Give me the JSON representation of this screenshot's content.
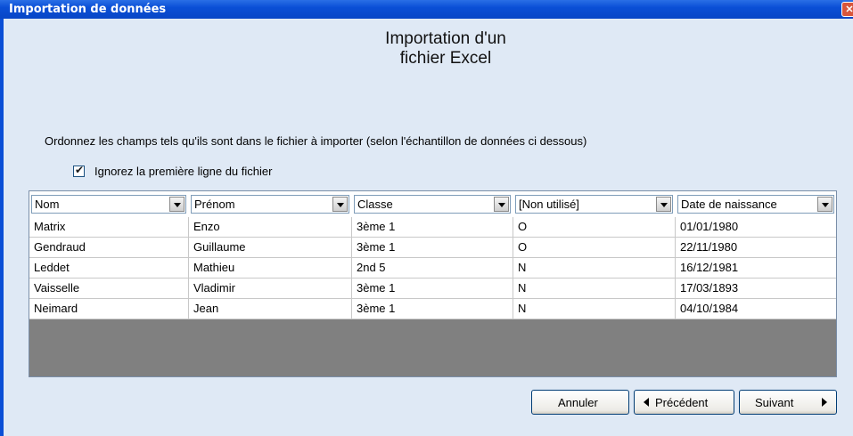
{
  "window": {
    "title": "Importation de données",
    "close_glyph": "✕"
  },
  "heading": {
    "line1": "Importation d'un",
    "line2": "fichier Excel"
  },
  "instruction": "Ordonnez les champs tels qu'ils sont dans le fichier à importer (selon l'échantillon de données ci dessous)",
  "checkbox": {
    "label": "Ignorez la première ligne du fichier",
    "checked": true
  },
  "grid": {
    "columns": [
      "Nom",
      "Prénom",
      "Classe",
      "[Non utilisé]",
      "Date de naissance"
    ],
    "rows": [
      [
        "Matrix",
        "Enzo",
        "3ème 1",
        "O",
        "01/01/1980"
      ],
      [
        "Gendraud",
        "Guillaume",
        "3ème 1",
        "O",
        "22/11/1980"
      ],
      [
        "Leddet",
        "Mathieu",
        "2nd 5",
        "N",
        "16/12/1981"
      ],
      [
        "Vaisselle",
        "Vladimir",
        "3ème 1",
        "N",
        "17/03/1893"
      ],
      [
        "Neimard",
        "Jean",
        "3ème 1",
        "N",
        "04/10/1984"
      ]
    ]
  },
  "buttons": {
    "cancel": "Annuler",
    "previous": "Précédent",
    "next": "Suivant"
  }
}
